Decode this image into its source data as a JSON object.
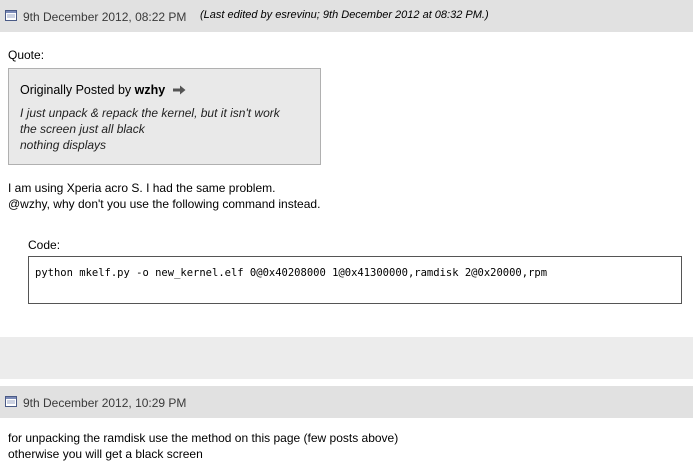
{
  "post1": {
    "date": "9th December 2012, 08:22 PM",
    "edit_note": "(Last edited by esrevinu; 9th December 2012 at 08:32 PM.)",
    "quote": {
      "label": "Quote:",
      "originally_posted_by": "Originally Posted by",
      "author": "wzhy",
      "lines": [
        "I just unpack & repack the kernel, but it isn't work",
        "the screen just all black",
        "nothing displays"
      ]
    },
    "message_lines": [
      "I am using Xperia acro S. I had the same problem.",
      "@wzhy, why don't you use the following command instead."
    ],
    "code": {
      "label": "Code:",
      "text": "python mkelf.py -o new_kernel.elf 0@0x40208000 1@0x41300000,ramdisk 2@0x20000,rpm"
    }
  },
  "post2": {
    "date": "9th December 2012, 10:29 PM",
    "message_lines": [
      "for unpacking the ramdisk use the method on this page (few posts above)",
      "otherwise you will get a black screen"
    ]
  },
  "icons": {
    "post_icon": "document-icon",
    "view_post_icon": "right-arrow-icon"
  },
  "colors": {
    "header_bg": "#e1e1e1",
    "quote_bg": "#e9e9e9",
    "separator_bg": "#ececec"
  }
}
